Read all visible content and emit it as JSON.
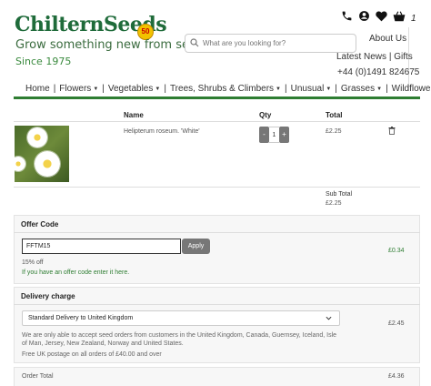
{
  "header": {
    "logo_text": "ChilternSeeds",
    "tagline": "Grow something new from seed",
    "since": "Since 1975",
    "search_placeholder": "What are you looking for?",
    "cart_count": "1",
    "links": {
      "about": "About Us",
      "news": "Latest News",
      "gifts": "Gifts",
      "phone": "+44 (0)1491 824675"
    }
  },
  "nav": {
    "items": [
      {
        "label": "Home",
        "dropdown": false
      },
      {
        "label": "Flowers",
        "dropdown": true
      },
      {
        "label": "Vegetables",
        "dropdown": true
      },
      {
        "label": "Trees, Shrubs & Climbers",
        "dropdown": true
      },
      {
        "label": "Unusual",
        "dropdown": true
      },
      {
        "label": "Grasses",
        "dropdown": true
      },
      {
        "label": "Wildflowers",
        "dropdown": true
      }
    ]
  },
  "cart": {
    "columns": {
      "name": "Name",
      "qty": "Qty",
      "total": "Total"
    },
    "items": [
      {
        "name": "Helipterum roseum. 'White'",
        "qty": "1",
        "minus": "-",
        "plus": "+",
        "total": "£2.25"
      }
    ],
    "subtotal_label": "Sub Total",
    "subtotal_value": "£2.25"
  },
  "offer": {
    "heading": "Offer Code",
    "code_value": "FFTM15",
    "apply_label": "Apply",
    "percent_off": "15% off",
    "help_text": "If you have an offer code enter it here.",
    "discount": "£0.34"
  },
  "delivery": {
    "heading": "Delivery charge",
    "selected": "Standard Delivery to United Kingdom",
    "note": "We are only able to accept seed orders from customers in the United Kingdom, Canada, Guernsey, Iceland, Isle of Man, Jersey, New Zealand, Norway and United States.",
    "free_note": "Free UK postage on all orders of £40.00 and over",
    "charge": "£2.45"
  },
  "order_total": {
    "label": "Order Total",
    "value": "£4.36"
  },
  "colors": {
    "brand_green": "#2e7d32",
    "button_grey": "#777777"
  }
}
